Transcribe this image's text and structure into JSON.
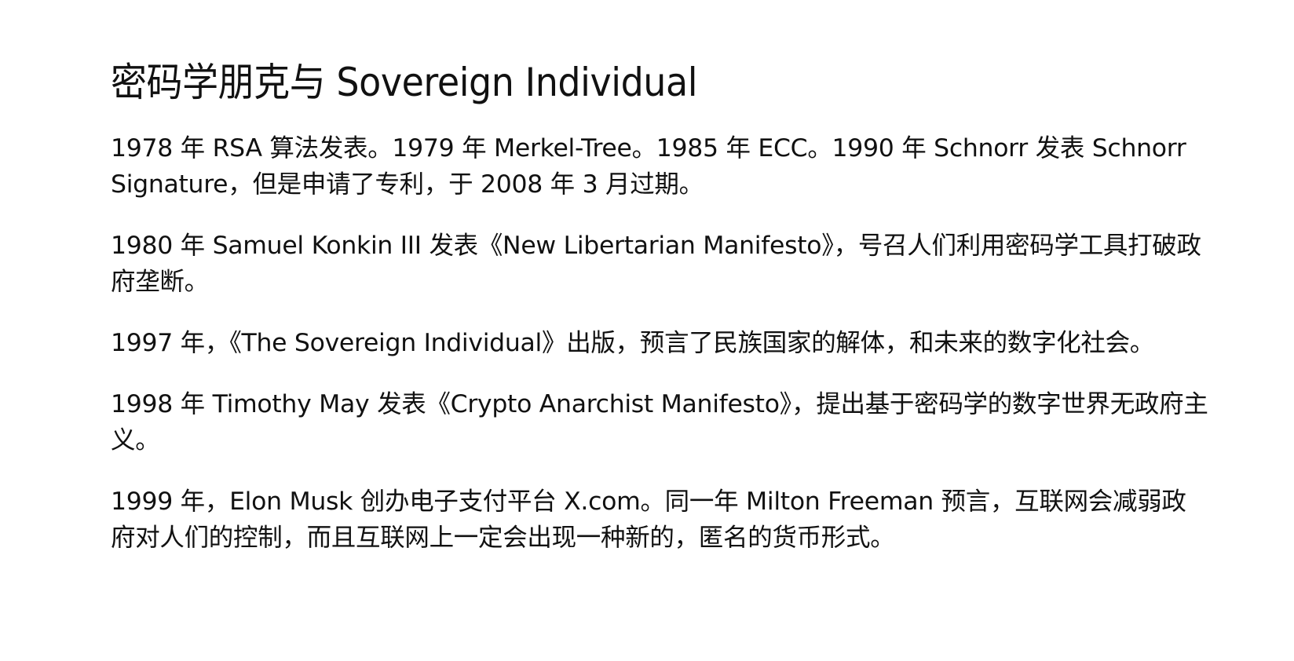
{
  "page": {
    "title": "密码学朋克与 Sovereign Individual",
    "paragraphs": [
      "1978 年 RSA 算法发表。1979 年 Merkel-Tree。1985 年 ECC。1990 年 Schnorr 发表 Schnorr Signature，但是申请了专利，于 2008 年 3 月过期。",
      "1980 年 Samuel Konkin III 发表《New Libertarian Manifesto》，号召人们利用密码学工具打破政府垄断。",
      "1997 年，《The Sovereign Individual》出版，预言了民族国家的解体，和未来的数字化社会。",
      "1998 年 Timothy May 发表《Crypto Anarchist Manifesto》，提出基于密码学的数字世界无政府主义。",
      "1999 年，Elon Musk 创办电子支付平台 X.com。同一年 Milton Freeman 预言，互联网会减弱政府对人们的控制，而且互联网上一定会出现一种新的，匿名的货币形式。"
    ]
  }
}
